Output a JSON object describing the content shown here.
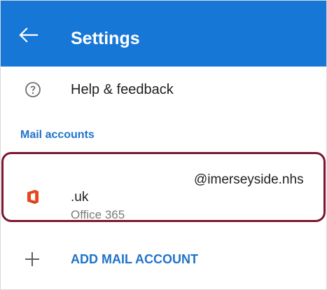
{
  "header": {
    "title": "Settings",
    "background_color": "#1777d6",
    "back_icon": "arrow-left-icon"
  },
  "help_item": {
    "label": "Help & feedback",
    "icon": "help-circle-icon"
  },
  "mail_accounts_section": {
    "header": "Mail accounts",
    "accounts": [
      {
        "email_suffix": "@imerseyside.nhs",
        "domain_end": ".uk",
        "type": "Office 365",
        "icon": "office-365-icon"
      }
    ],
    "highlight_color": "#7b1631"
  },
  "add_account": {
    "label": "ADD MAIL ACCOUNT",
    "icon": "plus-icon"
  },
  "colors": {
    "accent": "#1f73c9",
    "text_primary": "#202020",
    "text_secondary": "#7a7a7a"
  }
}
